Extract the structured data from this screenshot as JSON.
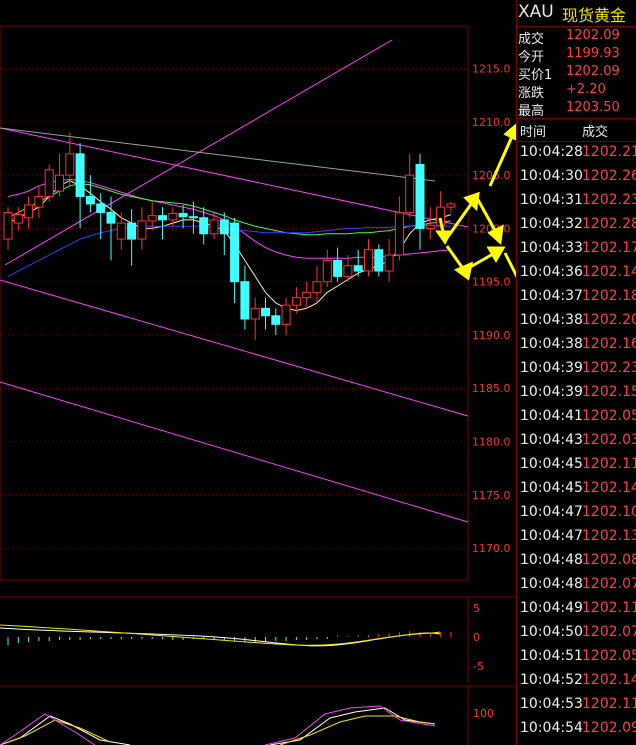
{
  "header": {
    "code": "XAU",
    "name": "现货黄金"
  },
  "quote": [
    {
      "label": "成交",
      "value": "1202.09"
    },
    {
      "label": "今开",
      "value": "1199.93"
    },
    {
      "label": "买价1",
      "value": "1202.09"
    },
    {
      "label": "涨跌",
      "value": "+2.20"
    },
    {
      "label": "最高",
      "value": "1203.50"
    }
  ],
  "ticks_header": {
    "time": "时间",
    "price": "成交"
  },
  "ticks": [
    {
      "time": "10:04:28",
      "price": "1202.21"
    },
    {
      "time": "10:04:30",
      "price": "1202.26"
    },
    {
      "time": "10:04:31",
      "price": "1202.23"
    },
    {
      "time": "10:04:32",
      "price": "1202.28"
    },
    {
      "time": "10:04:33",
      "price": "1202.17"
    },
    {
      "time": "10:04:36",
      "price": "1202.14"
    },
    {
      "time": "10:04:37",
      "price": "1202.18"
    },
    {
      "time": "10:04:38",
      "price": "1202.20"
    },
    {
      "time": "10:04:38",
      "price": "1202.16"
    },
    {
      "time": "10:04:39",
      "price": "1202.23"
    },
    {
      "time": "10:04:39",
      "price": "1202.15"
    },
    {
      "time": "10:04:41",
      "price": "1202.05"
    },
    {
      "time": "10:04:43",
      "price": "1202.03"
    },
    {
      "time": "10:04:45",
      "price": "1202.11"
    },
    {
      "time": "10:04:45",
      "price": "1202.14"
    },
    {
      "time": "10:04:47",
      "price": "1202.10"
    },
    {
      "time": "10:04:47",
      "price": "1202.13"
    },
    {
      "time": "10:04:48",
      "price": "1202.08"
    },
    {
      "time": "10:04:48",
      "price": "1202.07"
    },
    {
      "time": "10:04:49",
      "price": "1202.11"
    },
    {
      "time": "10:04:50",
      "price": "1202.07"
    },
    {
      "time": "10:04:51",
      "price": "1202.05"
    },
    {
      "time": "10:04:52",
      "price": "1202.14"
    },
    {
      "time": "10:04:53",
      "price": "1202.11"
    },
    {
      "time": "10:04:54",
      "price": "1202.09"
    }
  ],
  "price_axis": [
    "1215.0",
    "1210.0",
    "1205.0",
    "1200.0",
    "1195.0",
    "1190.0",
    "1185.0",
    "1180.0",
    "1175.0",
    "1170.0"
  ],
  "macd_axis": [
    "5",
    "0",
    "-5"
  ],
  "kdj_axis": [
    "100"
  ],
  "colors": {
    "up": "#ff3030",
    "down": "#40ffff",
    "grid": "#7a0000",
    "axis_text": "#ff3030",
    "arrow": "#ffff00",
    "channel": "#ff40ff"
  },
  "chart_data": {
    "type": "candlestick",
    "ylim": [
      1167,
      1219
    ],
    "candles": [
      [
        1199,
        1201.5,
        1198,
        1202
      ],
      [
        1200.5,
        1201.3,
        1199.8,
        1202
      ],
      [
        1201,
        1202.2,
        1200,
        1203
      ],
      [
        1202,
        1203,
        1201,
        1204
      ],
      [
        1203,
        1205.5,
        1202.5,
        1206
      ],
      [
        1203.5,
        1205,
        1203,
        1207
      ],
      [
        1205,
        1207,
        1204,
        1209
      ],
      [
        1207,
        1203,
        1200,
        1208
      ],
      [
        1203,
        1202.3,
        1201.5,
        1205
      ],
      [
        1202.3,
        1201.5,
        1199,
        1203.3
      ],
      [
        1201.5,
        1200.5,
        1197,
        1203
      ],
      [
        1199,
        1200.5,
        1198,
        1201.5
      ],
      [
        1200.5,
        1199,
        1196.5,
        1201.8
      ],
      [
        1199,
        1200.7,
        1198,
        1202
      ],
      [
        1200.7,
        1201.2,
        1199.8,
        1202.5
      ],
      [
        1201.2,
        1200.8,
        1199,
        1202
      ],
      [
        1200.8,
        1201.4,
        1200.2,
        1202
      ],
      [
        1201.4,
        1201.1,
        1200,
        1202.2
      ],
      [
        1201.1,
        1201,
        1199.5,
        1202.5
      ],
      [
        1201,
        1199.5,
        1198.5,
        1202
      ],
      [
        1199.5,
        1200.8,
        1199,
        1201.5
      ],
      [
        1200.8,
        1199.5,
        1197.5,
        1201.5
      ],
      [
        1200.5,
        1195,
        1193,
        1201
      ],
      [
        1195,
        1191.5,
        1190.5,
        1196.5
      ],
      [
        1191.5,
        1192.5,
        1189.5,
        1193.5
      ],
      [
        1192.5,
        1191.8,
        1190.5,
        1193.5
      ],
      [
        1191.8,
        1191,
        1190,
        1192.5
      ],
      [
        1191,
        1192.8,
        1190,
        1193.5
      ],
      [
        1192.8,
        1193.5,
        1192,
        1194.5
      ],
      [
        1193.5,
        1194,
        1192.5,
        1195
      ],
      [
        1194,
        1195,
        1193,
        1196.5
      ],
      [
        1195,
        1197,
        1194.5,
        1198
      ],
      [
        1197,
        1195.5,
        1195,
        1198.2
      ],
      [
        1195.5,
        1196.5,
        1195,
        1197.5
      ],
      [
        1196.5,
        1196,
        1195.5,
        1198
      ],
      [
        1196,
        1198,
        1195.5,
        1199
      ],
      [
        1198,
        1196,
        1195.5,
        1198.5
      ],
      [
        1196,
        1197.5,
        1195,
        1199
      ],
      [
        1197.5,
        1201.5,
        1197,
        1203
      ],
      [
        1201.5,
        1205,
        1201,
        1207
      ],
      [
        1206,
        1200,
        1198,
        1207
      ],
      [
        1200,
        1200.3,
        1199,
        1202
      ],
      [
        1200.3,
        1202,
        1200,
        1203.5
      ],
      [
        1202,
        1202.3,
        1201.5,
        1202.5
      ]
    ],
    "ma_series": [
      {
        "color": "#f5f5a0",
        "values": [
          1200.5,
          1201,
          1201.5,
          1202,
          1203,
          1204,
          1204.5,
          1204,
          1203.3,
          1202.5,
          1201.8,
          1201,
          1200.5,
          1200,
          1200,
          1200.2,
          1200.5,
          1200.8,
          1200.8,
          1200.5,
          1200.2,
          1199.8,
          1198.5,
          1197,
          1195.5,
          1194,
          1193,
          1192.5,
          1192.3,
          1192.5,
          1193,
          1194,
          1194.6,
          1195.2,
          1195.8,
          1196.2,
          1196.5,
          1197,
          1198,
          1199.5,
          1200.5,
          1200.8,
          1201,
          1201.3
        ]
      },
      {
        "color": "#ff40ff",
        "values": [
          1203,
          1203.2,
          1203.5,
          1204,
          1204.3,
          1204.5,
          1204.6,
          1204.5,
          1204.3,
          1204,
          1203.7,
          1203.4,
          1203.1,
          1202.8,
          1202.6,
          1202.4,
          1202.2,
          1202,
          1201.8,
          1201.5,
          1201.2,
          1200.8,
          1200.2,
          1199.5,
          1198.8,
          1198.2,
          1197.8,
          1197.5,
          1197.3,
          1197.2,
          1197.2,
          1197.2,
          1197.2,
          1197.2,
          1197.3,
          1197.3,
          1197.3,
          1197.4,
          1197.5,
          1197.6,
          1197.7,
          1197.8,
          1197.9,
          1198
        ]
      },
      {
        "color": "#40ff40",
        "values": [
          1201,
          1201.5,
          1202,
          1202.5,
          1203,
          1203.5,
          1204,
          1204.2,
          1204.1,
          1203.8,
          1203.5,
          1203.2,
          1203,
          1202.8,
          1202.6,
          1202.5,
          1202.4,
          1202.3,
          1202.1,
          1201.8,
          1201.5,
          1201.2,
          1200.8,
          1200.5,
          1200.2,
          1200,
          1199.8,
          1199.6,
          1199.5,
          1199.4,
          1199.4,
          1199.5,
          1199.5,
          1199.5,
          1199.6,
          1199.6,
          1199.7,
          1199.8,
          1200,
          1200.2,
          1200.3,
          1200.5,
          1200.6,
          1200.7
        ]
      },
      {
        "color": "#3040ff",
        "values": [
          1195.5,
          1196,
          1196.5,
          1197,
          1197.5,
          1198,
          1198.5,
          1199,
          1199.3,
          1199.6,
          1199.8,
          1200,
          1200.1,
          1200.2,
          1200.2,
          1200.2,
          1200.2,
          1200.2,
          1200.2,
          1200.2,
          1200.1,
          1200,
          1199.9,
          1199.8,
          1199.7,
          1199.6,
          1199.6,
          1199.6,
          1199.6,
          1199.6,
          1199.7,
          1199.8,
          1199.9,
          1200,
          1200,
          1200.1,
          1200.1,
          1200.1,
          1200.2,
          1200.2,
          1200.2,
          1200.2,
          1200.2,
          1200.2
        ]
      }
    ]
  }
}
